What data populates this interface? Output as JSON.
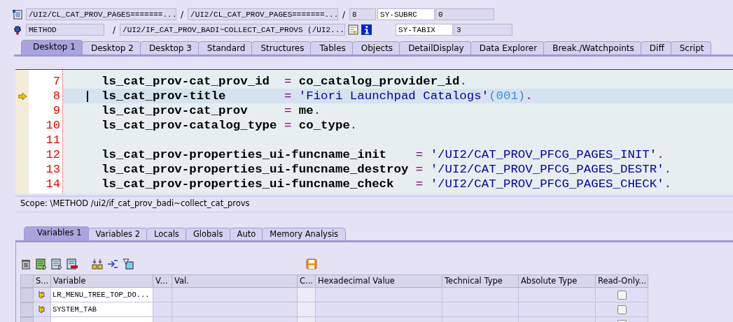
{
  "header": {
    "program": "/UI2/CL_CAT_PROV_PAGES=======...",
    "include": "/UI2/CL_CAT_PROV_PAGES=======...",
    "line": "8",
    "event_type": "METHOD",
    "event": "/UI2/IF_CAT_PROV_BADI~COLLECT_CAT_PROVS (/UI2...",
    "sys_fields": [
      {
        "name": "SY-SUBRC",
        "value": "0"
      },
      {
        "name": "SY-TABIX",
        "value": "3"
      }
    ],
    "separators": [
      "/",
      "/",
      "/"
    ]
  },
  "desktop_tabs": [
    {
      "label": "Desktop 1",
      "selected": true
    },
    {
      "label": "Desktop 2",
      "selected": false
    },
    {
      "label": "Desktop 3",
      "selected": false
    },
    {
      "label": "Standard",
      "selected": false
    },
    {
      "label": "Structures",
      "selected": false
    },
    {
      "label": "Tables",
      "selected": false
    },
    {
      "label": "Objects",
      "selected": false
    },
    {
      "label": "DetailDisplay",
      "selected": false
    },
    {
      "label": "Data Explorer",
      "selected": false
    },
    {
      "label": "Break./Watchpoints",
      "selected": false
    },
    {
      "label": "Diff",
      "selected": false
    },
    {
      "label": "Script",
      "selected": false
    }
  ],
  "code_lines": [
    {
      "number": "7",
      "current": false,
      "segments": [
        {
          "kind": "name",
          "text": "ls_cat_prov-cat_prov_id  "
        },
        {
          "kind": "op",
          "text": "="
        },
        {
          "kind": "name",
          "text": " co_catalog_provider_id"
        },
        {
          "kind": "op",
          "text": "."
        }
      ]
    },
    {
      "number": "8",
      "current": true,
      "segments": [
        {
          "kind": "name",
          "text": "ls_cat_prov-title        "
        },
        {
          "kind": "op",
          "text": "="
        },
        {
          "kind": "string",
          "text": " 'Fiori Launchpad Catalogs'"
        },
        {
          "kind": "textid",
          "text": "(001)"
        },
        {
          "kind": "op",
          "text": "."
        }
      ]
    },
    {
      "number": "9",
      "current": false,
      "segments": [
        {
          "kind": "name",
          "text": "ls_cat_prov-cat_prov     "
        },
        {
          "kind": "op",
          "text": "="
        },
        {
          "kind": "name",
          "text": " me"
        },
        {
          "kind": "op",
          "text": "."
        }
      ]
    },
    {
      "number": "10",
      "current": false,
      "segments": [
        {
          "kind": "name",
          "text": "ls_cat_prov-catalog_type "
        },
        {
          "kind": "op",
          "text": "="
        },
        {
          "kind": "name",
          "text": " co_type"
        },
        {
          "kind": "op",
          "text": "."
        }
      ]
    },
    {
      "number": "11",
      "current": false
    },
    {
      "number": "12",
      "current": false,
      "segments": [
        {
          "kind": "name",
          "text": "ls_cat_prov-properties_ui-funcname_init    "
        },
        {
          "kind": "op",
          "text": "="
        },
        {
          "kind": "string",
          "text": " '/UI2/CAT_PROV_PFCG_PAGES_INIT'"
        },
        {
          "kind": "op",
          "text": "."
        }
      ]
    },
    {
      "number": "13",
      "current": false,
      "segments": [
        {
          "kind": "name",
          "text": "ls_cat_prov-properties_ui-funcname_destroy "
        },
        {
          "kind": "op",
          "text": "="
        },
        {
          "kind": "string",
          "text": " '/UI2/CAT_PROV_PFCG_PAGES_DESTR'"
        },
        {
          "kind": "op",
          "text": "."
        }
      ]
    },
    {
      "number": "14",
      "current": false,
      "segments": [
        {
          "kind": "name",
          "text": "ls_cat_prov-properties_ui-funcname_check   "
        },
        {
          "kind": "op",
          "text": "="
        },
        {
          "kind": "string",
          "text": " '/UI2/CAT_PROV_PFCG_PAGES_CHECK'"
        },
        {
          "kind": "op",
          "text": "."
        }
      ]
    }
  ],
  "scope": "Scope: \\METHOD /ui2/if_cat_prov_badi~collect_cat_provs",
  "variable_tabs": [
    {
      "label": "Variables 1",
      "selected": true
    },
    {
      "label": "Variables 2",
      "selected": false
    },
    {
      "label": "Locals",
      "selected": false
    },
    {
      "label": "Globals",
      "selected": false
    },
    {
      "label": "Auto",
      "selected": false
    },
    {
      "label": "Memory Analysis",
      "selected": false
    }
  ],
  "table": {
    "columns": [
      "S...",
      "Variable",
      "V...",
      "Val.",
      "C...",
      "Hexadecimal Value",
      "Technical Type",
      "Absolute Type",
      "Read-Only..."
    ],
    "rows": [
      {
        "variable": "LR_MENU_TREE_TOP_DO...",
        "read_only": false
      },
      {
        "variable": "SYSTEM_TAB",
        "read_only": false
      },
      {
        "kind": "empty",
        "read_only": false
      }
    ]
  }
}
